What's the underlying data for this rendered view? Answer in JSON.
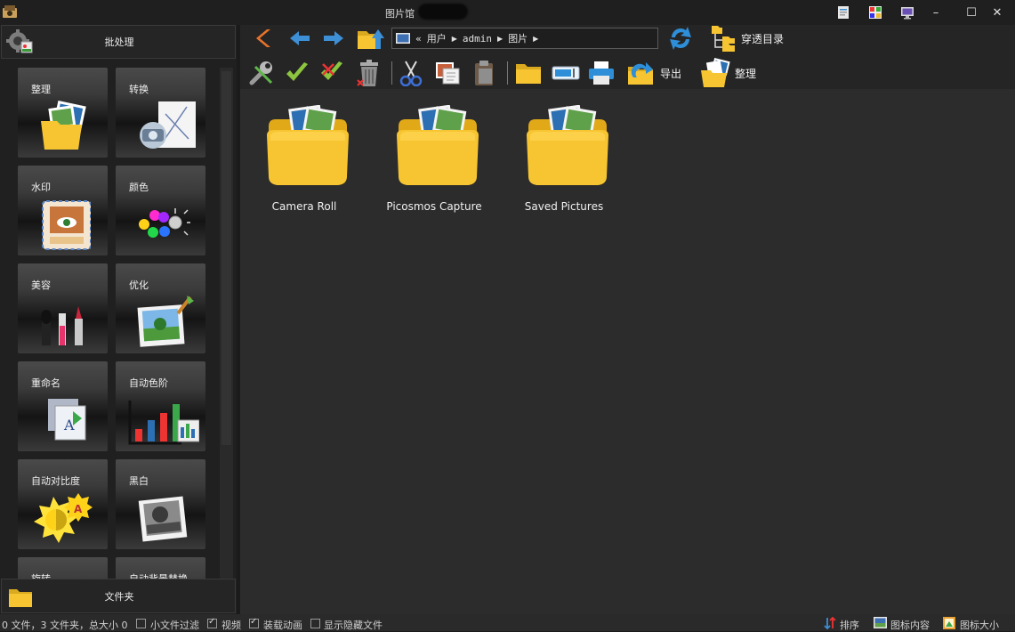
{
  "window": {
    "title": "图片馆",
    "minimize": "–",
    "maximize": "☐",
    "close": "✕"
  },
  "left": {
    "batch_label": "批处理",
    "folder_label": "文件夹",
    "tiles": [
      {
        "label": "整理"
      },
      {
        "label": "转换"
      },
      {
        "label": "水印"
      },
      {
        "label": "颜色"
      },
      {
        "label": "美容"
      },
      {
        "label": "优化"
      },
      {
        "label": "重命名"
      },
      {
        "label": "自动色阶"
      },
      {
        "label": "自动对比度"
      },
      {
        "label": "黑白"
      },
      {
        "label": "旋转"
      },
      {
        "label": "自动背景替换"
      }
    ]
  },
  "address": {
    "prefix": "«",
    "crumbs": [
      "用户",
      "admin",
      "图片"
    ]
  },
  "toolbar": {
    "tree_label": "穿透目录",
    "export_label": "导出",
    "organize_label": "整理"
  },
  "folders": [
    {
      "name": "Camera Roll"
    },
    {
      "name": "Picosmos Capture"
    },
    {
      "name": "Saved Pictures"
    }
  ],
  "status": {
    "summary": "0 文件，3 文件夹，总大小 0",
    "small_filter": "小文件过滤",
    "small_filter_checked": false,
    "video": "视频",
    "video_checked": true,
    "anim": "装载动画",
    "anim_checked": true,
    "hidden": "显示隐藏文件",
    "hidden_checked": false,
    "sort": "排序",
    "icon_content": "图标内容",
    "icon_size": "图标大小"
  },
  "colors": {
    "folder": "#f7c531",
    "accent_blue": "#3d8fd6",
    "accent_orange": "#e8732a",
    "check_green": "#8cc63f"
  }
}
